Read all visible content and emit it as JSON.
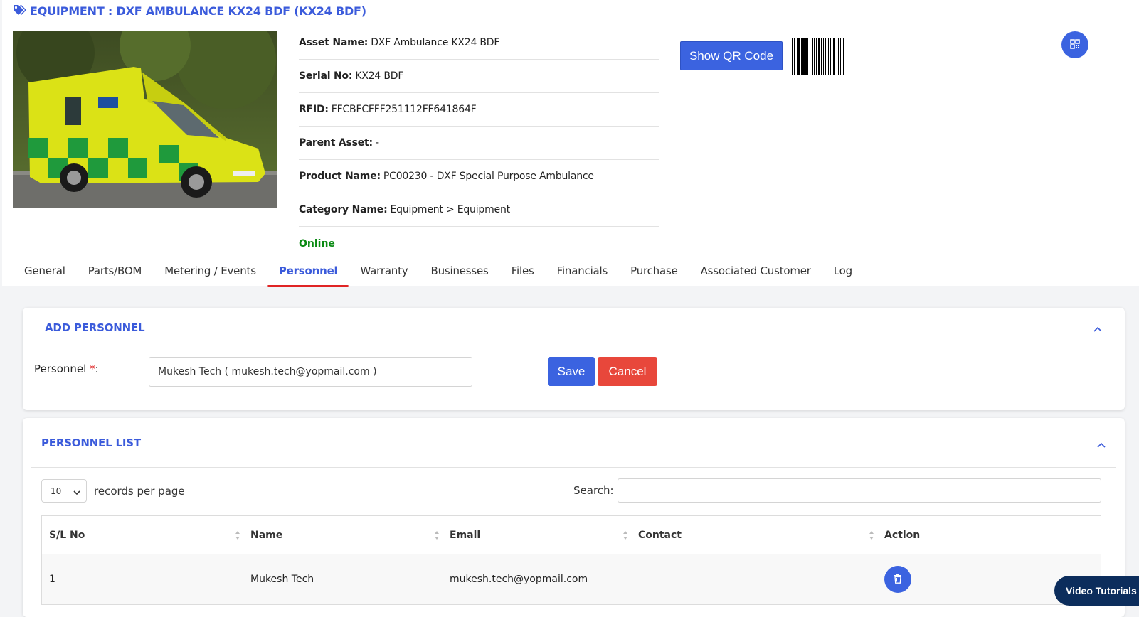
{
  "header": {
    "title": "EQUIPMENT : DXF AMBULANCE KX24 BDF (KX24 BDF)"
  },
  "asset": {
    "image_alt": "Ambulance photo",
    "fields": [
      {
        "label": "Asset Name:",
        "value": "DXF Ambulance KX24 BDF"
      },
      {
        "label": "Serial No:",
        "value": "KX24 BDF"
      },
      {
        "label": "RFID:",
        "value": "FFCBFCFFF251112FF641864F"
      },
      {
        "label": "Parent Asset:",
        "value": "-"
      },
      {
        "label": "Product Name:",
        "value": "PC00230 - DXF Special Purpose Ambulance"
      },
      {
        "label": "Category Name:",
        "value": "Equipment > Equipment"
      }
    ],
    "status": "Online",
    "status_color": "#0a8a12"
  },
  "actions": {
    "show_qr_label": "Show QR Code"
  },
  "tabs": [
    {
      "label": "General"
    },
    {
      "label": "Parts/BOM"
    },
    {
      "label": "Metering / Events"
    },
    {
      "label": "Personnel",
      "active": true
    },
    {
      "label": "Warranty"
    },
    {
      "label": "Businesses"
    },
    {
      "label": "Files"
    },
    {
      "label": "Financials"
    },
    {
      "label": "Purchase"
    },
    {
      "label": "Associated Customer"
    },
    {
      "label": "Log"
    }
  ],
  "add_personnel": {
    "title": "ADD PERSONNEL",
    "field_label": "Personnel",
    "required_mark": "*",
    "field_colon": ":",
    "value": "Mukesh Tech ( mukesh.tech@yopmail.com )",
    "save_label": "Save",
    "cancel_label": "Cancel"
  },
  "personnel_list": {
    "title": "PERSONNEL LIST",
    "page_length": "10",
    "records_label": "records per page",
    "search_label": "Search:",
    "search_value": "",
    "columns": [
      "S/L No",
      "Name",
      "Email",
      "Contact",
      "Action"
    ],
    "rows": [
      {
        "sl": "1",
        "name": "Mukesh Tech",
        "email": "mukesh.tech@yopmail.com",
        "contact": ""
      }
    ]
  },
  "footer": {
    "video_tutorials_label": "Video Tutorials"
  },
  "colors": {
    "accent": "#3b5bdb",
    "button_blue": "#3b63e0",
    "cancel_red": "#e8473b",
    "tab_underline": "#e02424"
  },
  "icons": {
    "title": "tag-icon",
    "qr": "qr-code-icon",
    "collapse": "chevron-up-icon",
    "sort": "sort-icon",
    "delete": "trash-icon"
  }
}
